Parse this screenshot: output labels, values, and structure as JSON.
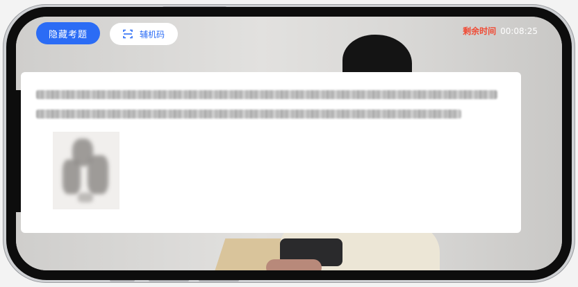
{
  "top_bar": {
    "hide_questions_label": "隐藏考题",
    "aux_code_label": "辅机码",
    "aux_code_icon": "scan-icon",
    "timer_label": "剩余时间",
    "timer_value": "00:08:25"
  },
  "colors": {
    "accent": "#2b6cf5",
    "timer_label": "#f04b35",
    "card": "#ffffff"
  },
  "question": {
    "text_blurred": true,
    "image_blurred": true
  }
}
